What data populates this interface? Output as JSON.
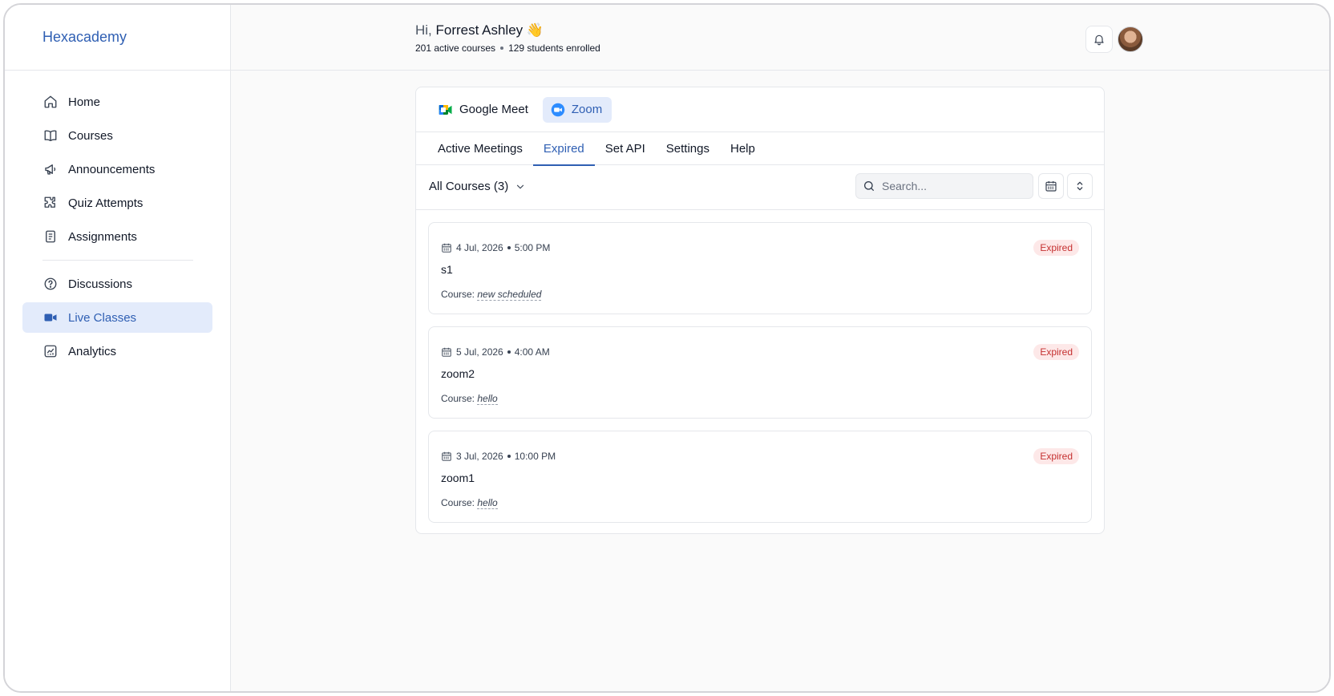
{
  "brand": "Hexacademy",
  "sidebar": {
    "items": [
      {
        "label": "Home",
        "icon": "home-icon"
      },
      {
        "label": "Courses",
        "icon": "book-icon"
      },
      {
        "label": "Announcements",
        "icon": "megaphone-icon"
      },
      {
        "label": "Quiz Attempts",
        "icon": "puzzle-icon"
      },
      {
        "label": "Assignments",
        "icon": "notebook-icon"
      },
      {
        "label": "Discussions",
        "icon": "help-circle-icon"
      },
      {
        "label": "Live Classes",
        "icon": "video-icon",
        "active": true
      },
      {
        "label": "Analytics",
        "icon": "chart-icon"
      }
    ]
  },
  "header": {
    "greeting_prefix": "Hi,",
    "user_name": "Forrest Ashley",
    "wave": "👋",
    "active_courses": "201 active courses",
    "students_enrolled": "129 students enrolled"
  },
  "providers": [
    {
      "label": "Google Meet",
      "icon": "google-meet-icon"
    },
    {
      "label": "Zoom",
      "icon": "zoom-icon",
      "active": true
    }
  ],
  "tabs": [
    {
      "label": "Active Meetings"
    },
    {
      "label": "Expired",
      "active": true
    },
    {
      "label": "Set API"
    },
    {
      "label": "Settings"
    },
    {
      "label": "Help"
    }
  ],
  "filters": {
    "course_filter": "All Courses (3)",
    "search_placeholder": "Search..."
  },
  "meetings": [
    {
      "date": "4 Jul, 2026",
      "time": "5:00 PM",
      "title": "s1",
      "course_label": "Course:",
      "course": "new scheduled",
      "status": "Expired"
    },
    {
      "date": "5 Jul, 2026",
      "time": "4:00 AM",
      "title": "zoom2",
      "course_label": "Course:",
      "course": "hello",
      "status": "Expired"
    },
    {
      "date": "3 Jul, 2026",
      "time": "10:00 PM",
      "title": "zoom1",
      "course_label": "Course:",
      "course": "hello",
      "status": "Expired"
    }
  ],
  "colors": {
    "accent": "#2f5fb3",
    "active_bg": "#e3ebfb",
    "expired_bg": "#fde8e8",
    "expired_text": "#c53030"
  }
}
